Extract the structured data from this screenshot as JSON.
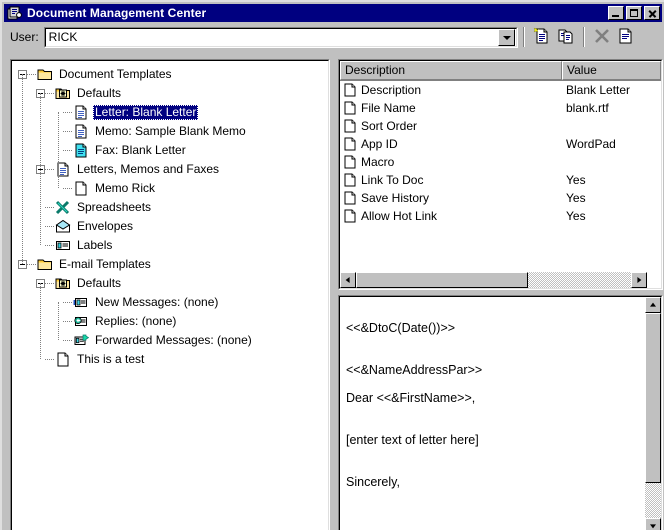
{
  "window": {
    "title": "Document Management Center",
    "icon": "document-management-icon",
    "controls": {
      "minimize": "Minimize",
      "maximize": "Maximize",
      "close": "Close"
    }
  },
  "toolbar": {
    "user_label": "User:",
    "user_value": "RICK",
    "user_placeholder": "",
    "buttons": [
      {
        "name": "new-document-button",
        "icon": "new-document-icon",
        "label": "New"
      },
      {
        "name": "copy-button",
        "icon": "copy-icon",
        "label": "Copy"
      },
      {
        "name": "delete-button",
        "icon": "delete-x-icon",
        "label": "Delete"
      },
      {
        "name": "properties-button",
        "icon": "properties-icon",
        "label": "Properties"
      }
    ]
  },
  "tree": {
    "nodes": [
      {
        "label": "Document Templates",
        "depth": 0,
        "icon": "folder-icon",
        "expander": "minus",
        "selected": false
      },
      {
        "label": "Defaults",
        "depth": 1,
        "icon": "defaults-folder-icon",
        "expander": "minus",
        "selected": false
      },
      {
        "label": "Letter: Blank Letter",
        "depth": 2,
        "icon": "document-blue-icon",
        "expander": "none",
        "selected": true
      },
      {
        "label": "Memo: Sample Blank Memo",
        "depth": 2,
        "icon": "document-blue-icon",
        "expander": "none",
        "selected": false
      },
      {
        "label": "Fax: Blank Letter",
        "depth": 2,
        "icon": "document-cyan-icon",
        "expander": "none",
        "selected": false
      },
      {
        "label": "Letters, Memos and Faxes",
        "depth": 1,
        "icon": "document-blue-icon",
        "expander": "minus",
        "selected": false
      },
      {
        "label": "Memo Rick",
        "depth": 2,
        "icon": "document-blank-icon",
        "expander": "none",
        "selected": false
      },
      {
        "label": "Spreadsheets",
        "depth": 1,
        "icon": "spreadsheet-x-icon",
        "expander": "none",
        "selected": false
      },
      {
        "label": "Envelopes",
        "depth": 1,
        "icon": "envelope-icon",
        "expander": "none",
        "selected": false
      },
      {
        "label": "Labels",
        "depth": 1,
        "icon": "label-icon",
        "expander": "none",
        "selected": false
      },
      {
        "label": "E-mail Templates",
        "depth": 0,
        "icon": "folder-icon",
        "expander": "minus",
        "selected": false
      },
      {
        "label": "Defaults",
        "depth": 1,
        "icon": "defaults-folder-icon",
        "expander": "minus",
        "selected": false
      },
      {
        "label": "New Messages: (none)",
        "depth": 2,
        "icon": "new-mail-icon",
        "expander": "none",
        "selected": false
      },
      {
        "label": "Replies: (none)",
        "depth": 2,
        "icon": "reply-mail-icon",
        "expander": "none",
        "selected": false
      },
      {
        "label": "Forwarded Messages: (none)",
        "depth": 2,
        "icon": "forward-mail-icon",
        "expander": "none",
        "selected": false
      },
      {
        "label": "This is a test",
        "depth": 1,
        "icon": "document-blank-icon",
        "expander": "none",
        "selected": false
      }
    ]
  },
  "properties": {
    "columns": [
      "Description",
      "Value"
    ],
    "rows": [
      {
        "icon": "document-blank-icon",
        "description": "Description",
        "value": "Blank Letter"
      },
      {
        "icon": "document-blank-icon",
        "description": "File Name",
        "value": "blank.rtf"
      },
      {
        "icon": "document-blank-icon",
        "description": "Sort Order",
        "value": ""
      },
      {
        "icon": "document-blank-icon",
        "description": "App ID",
        "value": "WordPad"
      },
      {
        "icon": "document-blank-icon",
        "description": "Macro",
        "value": ""
      },
      {
        "icon": "document-blank-icon",
        "description": "Link To Doc",
        "value": "Yes"
      },
      {
        "icon": "document-blank-icon",
        "description": "Save History",
        "value": "Yes"
      },
      {
        "icon": "document-blank-icon",
        "description": "Allow Hot Link",
        "value": "Yes"
      }
    ]
  },
  "preview": {
    "lines": [
      "",
      "<<&DtoC(Date())>>",
      "",
      "",
      "<<&NameAddressPar>>",
      "",
      "Dear <<&FirstName>>,",
      "",
      "",
      "[enter text of letter here]",
      "",
      "",
      "Sincerely,"
    ]
  },
  "colors": {
    "titlebar": "#000080",
    "face": "#c0c0c0",
    "selection": "#000080",
    "folder": "#ffe9a0",
    "accent_cyan": "#00ffff"
  }
}
